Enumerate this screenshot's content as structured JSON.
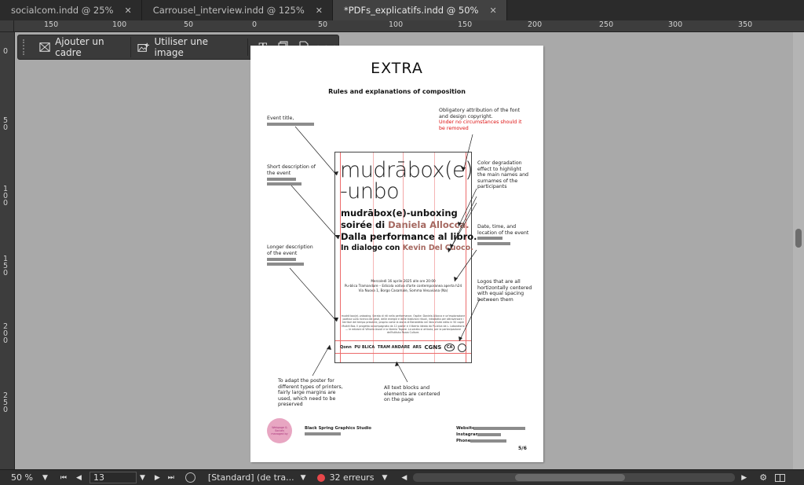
{
  "tabs": [
    {
      "label": "socialcom.indd @ 25%"
    },
    {
      "label": "Carrousel_interview.indd @ 125%"
    },
    {
      "label": "*PDFs_explicatifs.indd @ 50%"
    }
  ],
  "ruler": {
    "h": [
      "150",
      "100",
      "50",
      "0",
      "50",
      "100",
      "150",
      "200",
      "250",
      "300",
      "350"
    ],
    "v": [
      "0",
      "5\n0",
      "1\n0\n0",
      "1\n5\n0",
      "2\n0\n0",
      "2\n5\n0"
    ]
  },
  "context_bar": {
    "frame_label": "Ajouter un cadre",
    "image_label": "Utiliser une image"
  },
  "doc": {
    "title": "EXTRA",
    "subtitle": "Rules and explanations of composition",
    "notes": {
      "event_title": "Event title,",
      "short_desc": "Short description of the event",
      "longer_desc": "Longer description of the event",
      "copyright": "Obligatory attribution of the font and design copyright.",
      "copyright_warning": "Under no circumstances should it be removed",
      "color": "Color degradation effect to highlight the main names and surnames of the participants",
      "date": "Date, time, and location of the event",
      "logos": "Logos that are all hortizontally centered with equal spacing between them",
      "margins": "To adapt the poster for different types of printers, fairly large margins are used, which need to be preserved",
      "centered": "All text blocks and elements are centered on the page"
    },
    "poster": {
      "big_title_1": "mudrābox(e)",
      "big_title_2": "-unbo",
      "h1": "mudrābox(e)-unboxing",
      "h2a": "soirée di ",
      "h2b": "Daniela Allocca.",
      "h3": "Dalla performance al libro.",
      "h4a": "In dialogo con ",
      "h4b": "Kevin Del Cuoco.",
      "date_line_1": "Mercoledì 16 aprile 2025 alle ore 20:00",
      "date_line_2": "Pu-blica Tramandare – Edicola votiva d'arte contemporanea aperta h24",
      "date_line_3": "Via Nuova 1, Borgo Casamale, Somma Vesuviana (Na)",
      "body": "mudrā box(e)-unboxing. Serata di riti nella performance. Ospite: Daniela Allocca e un'esplorazione poetica sulla ricerca dei gesti, delle energie e delle tradizioni rituali, introdotta per attraversare i territori del tempo presente, proprio come la storia di Benedetta nel libro d'arte edito in 50 copie Mudrā Box. Il progetto accompagnato da 12 poster e il liberto ideato da Pu-blica da L. Laboratorio — le edizioni di Vittoria Ascoli e la libreria Tagore. La serata si articola, per la partecipazione dell'Istituto Pozzo Culture.",
      "logos": [
        "Qonn",
        "PU BLICA",
        "TRAM ANDARE",
        "ARS",
        "CGNS",
        "CA"
      ]
    },
    "studio": "Black Spring Graphics Studio",
    "contacts": {
      "website": "Website:",
      "instagram": "Instagram:",
      "phone": "Phone:"
    },
    "badge": "Webpage & Socials managed by",
    "page_num": "5/6"
  },
  "statusbar": {
    "zoom": "50 %",
    "page": "13",
    "style": "[Standard] (de tra...",
    "errors": "32 erreurs"
  },
  "colors": {
    "accent_red": "#e8474a",
    "poster_grad": "#b07066",
    "badge": "#e8a6c2"
  }
}
